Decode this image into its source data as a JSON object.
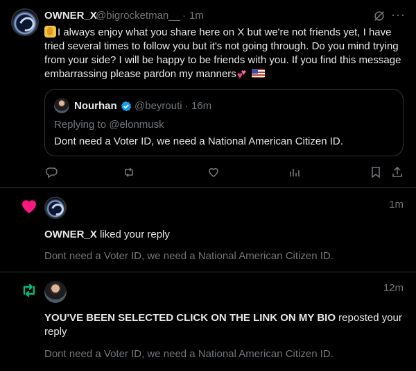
{
  "tweet": {
    "author_name": "OWNER_X",
    "author_handle": "@bigrocketman__",
    "separator": "·",
    "time": "1m",
    "body": "I always enjoy what you share here on X but we're not friends yet, I have tried several times to follow you but it's not going through. Do you mind trying from your side? I will be happy to be friends with you. If you find this message embarrassing please pardon my manners",
    "icons": {
      "mute": "muted-icon",
      "more": "more-icon"
    },
    "quoted": {
      "name": "Nourhan",
      "handle": "@beyrouti",
      "separator": "·",
      "time": "16m",
      "replying": "Replying to @elonmusk",
      "text": "Dont need a Voter ID, we need a National American Citizen ID."
    },
    "actions": [
      "reply-icon",
      "retweet-icon",
      "like-icon",
      "analytics-icon",
      "bookmark-icon",
      "share-icon"
    ]
  },
  "notifications": [
    {
      "type": "like",
      "icon": "heart-icon",
      "icon_color": "#f91880",
      "time": "1m",
      "actor": "OWNER_X",
      "action": " liked your reply",
      "snippet": "Dont need a Voter ID, we need a National American Citizen ID."
    },
    {
      "type": "repost",
      "icon": "repost-icon",
      "icon_color": "#00ba7c",
      "time": "12m",
      "actor": "YOU'VE BEEN SELECTED CLICK ON THE LINK ON MY BIO",
      "action": " reposted your reply",
      "snippet": "Dont need a Voter ID, we need a National American Citizen ID."
    }
  ],
  "colors": {
    "background": "#000000",
    "text": "#e7e9ea",
    "muted": "#71767b",
    "border": "#2f3336",
    "verified": "#1d9bf0"
  }
}
